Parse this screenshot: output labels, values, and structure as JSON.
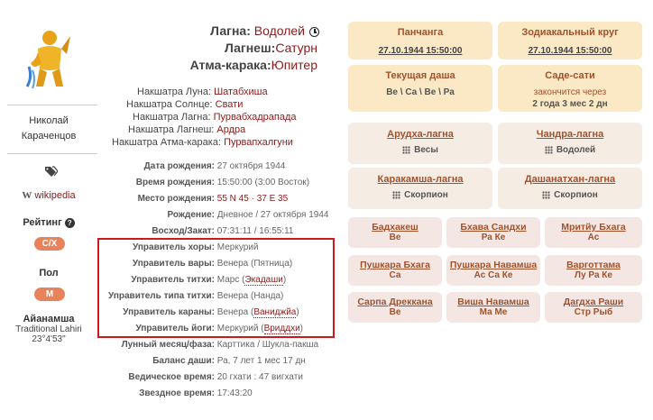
{
  "profile": {
    "name_line1": "Николай",
    "name_line2": "Караченцов",
    "wiki_label": "wikipedia",
    "rating_label": "Рейтинг",
    "rating_value": "C/X",
    "sex_label": "Пол",
    "sex_value": "М",
    "ayanamsha_title": "Айанамша",
    "ayanamsha_system": "Traditional Lahiri",
    "ayanamsha_value": "23°4'53\""
  },
  "lagna_block": [
    {
      "label": "Лагна:",
      "value": "Водолей"
    },
    {
      "label": "Лагнеш:",
      "value": "Сатурн"
    },
    {
      "label": "Атма-карака:",
      "value": "Юпитер"
    }
  ],
  "nakshatras": [
    {
      "label": "Накшатра Луна:",
      "value": "Шатабхиша"
    },
    {
      "label": "Накшатра Солнце:",
      "value": "Свати"
    },
    {
      "label": "Накшатра Лагна:",
      "value": "Пурвабхадрапада"
    },
    {
      "label": "Накшатра Лагнеш:",
      "value": "Ардра"
    },
    {
      "label": "Накшатра Атма-карака:",
      "value": "Пурвапхалгуни"
    }
  ],
  "info": [
    {
      "label": "Дата рождения:",
      "value": "27 октября 1944"
    },
    {
      "label": "Время рождения:",
      "value": "15:50:00 (3:00 Восток)"
    },
    {
      "label": "Место рождения:",
      "value": "55 N 45 · 37 E 35"
    },
    {
      "label": "Рождение:",
      "value": "Дневное / 27 октября 1944"
    },
    {
      "label": "Восход/Закат:",
      "value": "07:31:11 / 16:55:11"
    },
    {
      "label": "Управитель хоры:",
      "value": "Меркурий"
    },
    {
      "label": "Управитель вары:",
      "value": "Венера (Пятница)"
    },
    {
      "label": "Управитель титхи:",
      "value": "Марс (",
      "link": "Экадаши",
      "tail": ")"
    },
    {
      "label": "Управитель типа титхи:",
      "value": "Венера (Нанда)"
    },
    {
      "label": "Управитель караны:",
      "value": "Венера (",
      "link": "Ваниджйа",
      "tail": ")"
    },
    {
      "label": "Управитель йоги:",
      "value": "Меркурий (",
      "link": "Вриддхи",
      "tail": ")"
    },
    {
      "label": "Лунный месяц/фаза:",
      "value": "Карттика / Шукла-пакша"
    },
    {
      "label": "Баланс даши:",
      "value": "Ра, 7 лет 1 мес 17 дн"
    },
    {
      "label": "Ведическое время:",
      "value": "20 гхати : 47 вигхати"
    },
    {
      "label": "Звездное время:",
      "value": "17:43:20"
    }
  ],
  "cards": {
    "panchanga": {
      "title": "Панчанга",
      "sub": "27.10.1944 15:50:00"
    },
    "zodiac": {
      "title": "Зодиакальный круг",
      "sub": "27.10.1944 15:50:00"
    },
    "dasha": {
      "title": "Текущая даша",
      "sub": "Ве \\ Са \\ Ве \\ Ра"
    },
    "sadesati": {
      "title": "Саде-сати",
      "line1": "закончится через",
      "line2": "2 года 3 мес 2 дн"
    },
    "arudha": {
      "title": "Арудха-лагна",
      "sign": "Весы"
    },
    "chandra": {
      "title": "Чандра-лагна",
      "sign": "Водолей"
    },
    "karakamsha": {
      "title": "Каракамша-лагна",
      "sign": "Скорпион"
    },
    "dashanatkhan": {
      "title": "Дашанатхан-лагна",
      "sign": "Скорпион"
    }
  },
  "pink_cards": [
    {
      "title": "Бадхакеш",
      "sub": "Ве"
    },
    {
      "title": "Бхава Сандхи",
      "sub": "Ра Ке"
    },
    {
      "title": "Мритйу Бхага",
      "sub": "Ас"
    },
    {
      "title": "Пушкара Бхага",
      "sub": "Са"
    },
    {
      "title": "Пушкара Навамша",
      "sub": "Ас Са Ке"
    },
    {
      "title": "Варготтама",
      "sub": "Лу Ра Ке"
    },
    {
      "title": "Сарпа Дреккана",
      "sub": "Ве"
    },
    {
      "title": "Виша Навамша",
      "sub": "Ма Ме"
    },
    {
      "title": "Дагдха Раши",
      "sub": "Стр Рыб"
    }
  ]
}
